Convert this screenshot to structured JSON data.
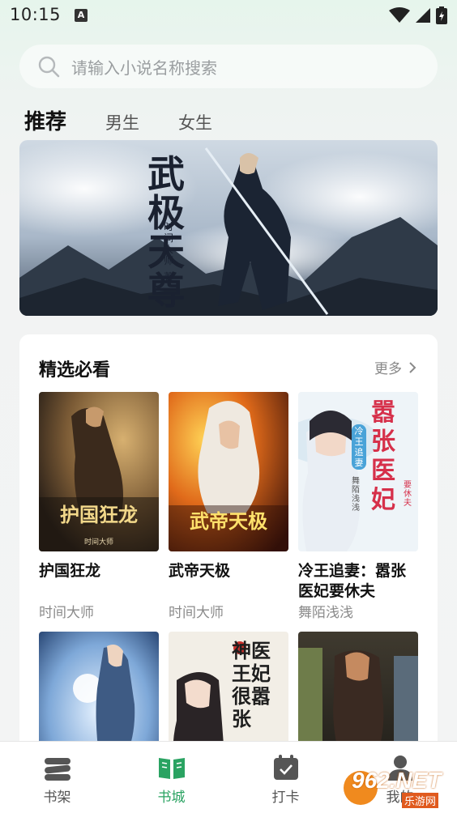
{
  "status_bar": {
    "time": "10:15",
    "notif_glyph": "A",
    "icons": [
      "wifi-icon",
      "signal-icon",
      "battery-icon"
    ]
  },
  "search": {
    "placeholder": "请输入小说名称搜索",
    "icon": "search-icon"
  },
  "tabs": [
    {
      "label": "推荐",
      "active": true
    },
    {
      "label": "男生",
      "active": false
    },
    {
      "label": "女生",
      "active": false
    }
  ],
  "banner": {
    "title": "武极天尊",
    "author_line": "时间大师",
    "seal": "著"
  },
  "featured": {
    "title": "精选必看",
    "more_label": "更多",
    "books": [
      {
        "title": "护国狂龙",
        "author": "时间大师",
        "cover_text": "护国狂龙",
        "cover_sub": "时间大师"
      },
      {
        "title": "武帝天极",
        "author": "时间大师",
        "cover_text": "武帝天极"
      },
      {
        "title": "冷王追妻：嚣张医妃要休夫",
        "author": "舞陌浅浅",
        "cover_text": "嚣张医妃",
        "cover_tag": "冷王追妻",
        "cover_sub": "舞陌浅浅",
        "cover_extra": "要休夫"
      },
      {
        "title": "",
        "author": "",
        "cover_text": ""
      },
      {
        "title": "",
        "author": "",
        "cover_text": "神医王妃很嚣张"
      },
      {
        "title": "",
        "author": "",
        "cover_text": ""
      }
    ]
  },
  "bottom_nav": [
    {
      "label": "书架",
      "icon": "bookshelf-icon",
      "active": false
    },
    {
      "label": "书城",
      "icon": "open-book-icon",
      "active": true
    },
    {
      "label": "打卡",
      "icon": "calendar-check-icon",
      "active": false
    },
    {
      "label": "我的",
      "icon": "user-icon",
      "active": false
    }
  ],
  "watermark": {
    "text": "962.NET",
    "sub": "乐游网"
  },
  "colors": {
    "accent": "#2aa362",
    "text": "#111111",
    "muted": "#8b8b8b"
  }
}
